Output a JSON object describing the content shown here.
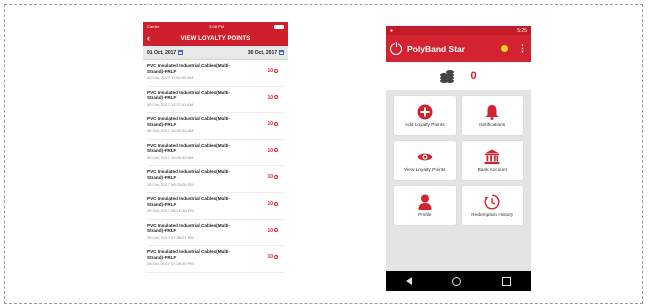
{
  "left_screen": {
    "status": {
      "carrier": "Carrier",
      "time": "3:08 PM"
    },
    "header": {
      "back": "‹",
      "title": "VIEW LOYALTY POINTS"
    },
    "dates": {
      "from": "01 Oct, 2017",
      "to": "30 Oct, 2017"
    },
    "rows": [
      {
        "name": "PVC Insulated Industrial Cables(Multi-Strand)-FRLF",
        "date": "30 Oct, 2017 11:54:00 AM",
        "points": "10"
      },
      {
        "name": "PVC Insulated Industrial Cables(Multi-Strand)-FRLF",
        "date": "30 Oct, 2017 11:37:41 AM",
        "points": "10"
      },
      {
        "name": "PVC Insulated Industrial Cables(Multi-Strand)-FRLF",
        "date": "30 Oct, 2017 10:02:34 AM",
        "points": "10"
      },
      {
        "name": "PVC Insulated Industrial Cables(Multi-Strand)-FRLF",
        "date": "30 Oct, 2017 10:00:43 AM",
        "points": "10"
      },
      {
        "name": "PVC Insulated Industrial Cables(Multi-Strand)-FRLF",
        "date": "29 Oct, 2017 08:23:08 PM",
        "points": "10"
      },
      {
        "name": "PVC Insulated Industrial Cables(Multi-Strand)-FRLF",
        "date": "29 Oct, 2017 08:16:38 PM",
        "points": "10"
      },
      {
        "name": "PVC Insulated Industrial Cables(Multi-Strand)-FRLF",
        "date": "29 Oct, 2017 07:58:21 PM",
        "points": "10"
      },
      {
        "name": "PVC Insulated Industrial Cables(Multi-Strand)-FRLF",
        "date": "28 Oct, 2017 07:28:30 PM",
        "points": "10"
      }
    ]
  },
  "right_screen": {
    "status": {
      "time": "5:25"
    },
    "header": {
      "title": "PolyBand Star",
      "menu": "⋮"
    },
    "points_value": "0",
    "tiles": [
      {
        "label": "Add Loyalty Points",
        "icon": "plus-circle-icon"
      },
      {
        "label": "Notifications",
        "icon": "bell-icon"
      },
      {
        "label": "View Loyalty Points",
        "icon": "eye-icon"
      },
      {
        "label": "Bank Account",
        "icon": "bank-icon"
      },
      {
        "label": "Profile",
        "icon": "person-icon"
      },
      {
        "label": "Redemption History",
        "icon": "history-clock-icon"
      }
    ]
  },
  "colors": {
    "brand_red": "#cf1f2c",
    "accent_yellow": "#f7d41c"
  }
}
